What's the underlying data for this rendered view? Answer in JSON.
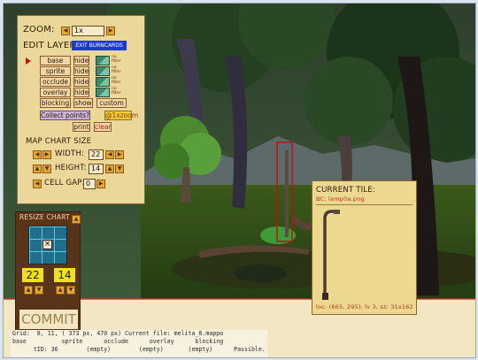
{
  "zoom": {
    "label": "ZOOM:",
    "value": "1x"
  },
  "edit_layer": {
    "label": "EDIT LAYER:",
    "button": "EXIT BURNCARDS"
  },
  "layers": [
    {
      "name": "base",
      "toggle": "hide",
      "filter": "no filter"
    },
    {
      "name": "sprite",
      "toggle": "hide",
      "filter": "no filter"
    },
    {
      "name": "occlude",
      "toggle": "hide",
      "filter": "no filter"
    },
    {
      "name": "overlay",
      "toggle": "hide",
      "filter": "no filter"
    },
    {
      "name": "blocking",
      "toggle": "show",
      "filter": "custom"
    }
  ],
  "collect_points": "Collect points?",
  "zoom_tag": "@1xzoom",
  "print_label": "print",
  "clear_label": "clear",
  "map_chart": {
    "title": "MAP CHART SIZE",
    "width_label": "WIDTH:",
    "width_value": "22",
    "height_label": "HEIGHT:",
    "height_value": "14",
    "gap_label": "CELL GAP:",
    "gap_value": "0"
  },
  "resize_chart": {
    "title": "RESIZE CHART",
    "width": "22",
    "height": "14",
    "commit": "COMMIT"
  },
  "current_tile": {
    "title": "CURRENT TILE:",
    "file": "BC: lamp0a.png",
    "info": "loc: (665, 295), lv 3, sz: 31x162"
  },
  "status": {
    "line1": "Grid:  8, 11, ( 373 px, 470 px) Current file: melita_8.mappo",
    "line2": "base          sprite      occlude      overlay      blocking",
    "line3": "      tID: 36        (empty)        (empty)       (empty)      Passible."
  },
  "colors": {
    "panel": "#ecd79a",
    "accent": "#e0a83a",
    "exit_button": "#1a3ad8",
    "selection": "#c01010"
  }
}
